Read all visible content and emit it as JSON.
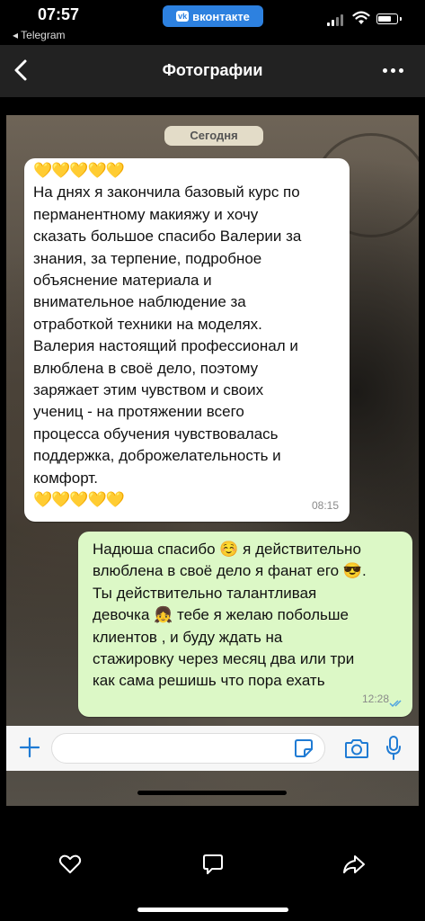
{
  "status_bar": {
    "time": "07:57",
    "back_app": "◂ Telegram",
    "vk_label": "вконтакте",
    "vk_logo": "vk"
  },
  "nav": {
    "title": "Фотографии",
    "back_icon": "chevron-left-icon",
    "more_icon": "more-horizontal-icon"
  },
  "chat": {
    "date_chip": "Сегодня",
    "incoming": {
      "hearts_top": "💛💛💛💛💛",
      "lines": [
        "На днях я закончила базовый курс по",
        "перманентному макияжу и хочу",
        "сказать большое спасибо Валерии за",
        "знания, за терпение, подробное",
        "объяснение материала и",
        "внимательное наблюдение за",
        "отработкой техники на моделях.",
        "Валерия настоящий профессионал и",
        "влюблена в своё дело, поэтому",
        "заряжает этим чувством и своих",
        "учениц - на протяжении всего",
        "процесса обучения чувствовалась",
        "поддержка, доброжелательность и",
        "комфорт."
      ],
      "hearts_bottom": "💛💛💛💛💛",
      "time": "08:15"
    },
    "outgoing": {
      "lines": [
        "Надюша спасибо ☺️ я действительно",
        "влюблена в своё дело я фанат его 😎.",
        "Ты действительно талантливая",
        "девочка 👧 тебе я желаю побольше",
        "клиентов , и буду ждать на",
        "стажировку через месяц два или три",
        "как сама решишь что пора ехать"
      ],
      "time": "12:28",
      "status_icon": "double-check-icon"
    }
  },
  "colors": {
    "incoming_bubble": "#ffffff",
    "outgoing_bubble": "#dcf8c6",
    "accent": "#1f7bd4",
    "vk_blue": "#2d81e0",
    "nav_bg": "#222222"
  },
  "toolbar": {
    "icons": [
      "heart-icon",
      "comment-icon",
      "share-icon"
    ]
  }
}
